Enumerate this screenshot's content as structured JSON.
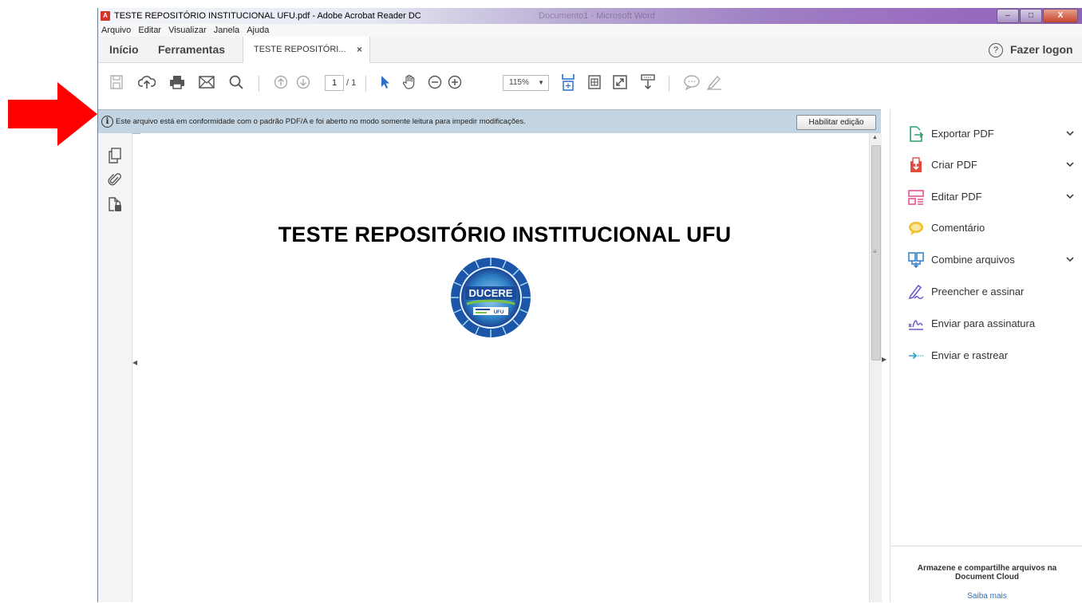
{
  "window": {
    "title": "TESTE REPOSITÓRIO INSTITUCIONAL UFU.pdf - Adobe Acrobat Reader DC",
    "background_title": "Documento1 - Microsoft Word",
    "controls": {
      "minimize": "–",
      "maximize": "□",
      "close": "X"
    }
  },
  "menu": [
    "Arquivo",
    "Editar",
    "Visualizar",
    "Janela",
    "Ajuda"
  ],
  "tabs": {
    "home": "Início",
    "tools": "Ferramentas",
    "document": "TESTE REPOSITÓRI...",
    "close_symbol": "×",
    "help_symbol": "?",
    "sign_in": "Fazer logon"
  },
  "toolbar": {
    "page_current": "1",
    "page_total": "/ 1",
    "zoom": "115%",
    "zoom_caret": "▼",
    "icons": [
      "save-icon",
      "upload-cloud-icon",
      "print-icon",
      "email-icon",
      "search-icon",
      "page-up-icon",
      "page-down-icon",
      "select-cursor-icon",
      "hand-tool-icon",
      "zoom-out-icon",
      "zoom-in-icon",
      "fit-page-icon",
      "page-view-icon",
      "fullscreen-icon",
      "scroll-mode-icon",
      "comment-icon",
      "pen-icon"
    ]
  },
  "infobar": {
    "icon_symbol": "i",
    "message": "Este arquivo está em conformidade com o padrão PDF/A e foi aberto no modo somente leitura para impedir modificações.",
    "button": "Habilitar edição",
    "background": "#c4d5e1"
  },
  "document": {
    "title": "TESTE REPOSITÓRIO INSTITUCIONAL UFU",
    "logo_text": "DUCERE",
    "logo_subtext": "UFU"
  },
  "left_rail": {
    "icons": [
      "page-thumbnails-icon",
      "attachments-icon",
      "document-security-icon"
    ],
    "collapse_symbol": "◀"
  },
  "scrollbar": {
    "up": "▲",
    "grip": "≡"
  },
  "right_pane": {
    "collapse_symbol": "▶",
    "items": [
      {
        "label": "Exportar PDF",
        "icon": "export-pdf-icon",
        "color": "#2f9e6b",
        "has_chevron": true
      },
      {
        "label": "Criar PDF",
        "icon": "create-pdf-icon",
        "color": "#e04b3c",
        "has_chevron": true
      },
      {
        "label": "Editar PDF",
        "icon": "edit-pdf-icon",
        "color": "#e0558f",
        "has_chevron": true
      },
      {
        "label": "Comentário",
        "icon": "comment-icon",
        "color": "#f2c134",
        "has_chevron": false
      },
      {
        "label": "Combine arquivos",
        "icon": "combine-files-icon",
        "color": "#2b7ccc",
        "has_chevron": true
      },
      {
        "label": "Preencher e assinar",
        "icon": "fill-sign-icon",
        "color": "#6c5ac9",
        "has_chevron": false
      },
      {
        "label": "Enviar para assinatura",
        "icon": "send-signature-icon",
        "color": "#6c5ac9",
        "has_chevron": false
      },
      {
        "label": "Enviar e rastrear",
        "icon": "send-track-icon",
        "color": "#2aa3c9",
        "has_chevron": false
      }
    ],
    "cloud_text": "Armazene e compartilhe arquivos na Document Cloud",
    "cloud_link": "Saiba mais"
  },
  "colors": {
    "annotation_arrow": "#ff0000",
    "acrobat_red": "#d8332b",
    "link": "#2d6fb7"
  }
}
